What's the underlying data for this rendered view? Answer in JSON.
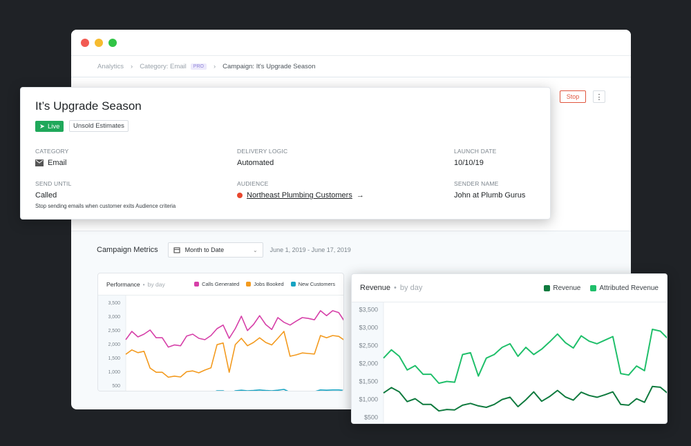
{
  "breadcrumb": {
    "items": [
      "Analytics",
      "Category: Email",
      "Campaign: It's Upgrade Season"
    ],
    "badge": "PRO"
  },
  "header": {
    "stop_label": "Stop",
    "more_icon": "kebab-icon"
  },
  "campaign": {
    "title": "It’s Upgrade Season",
    "status": "Live",
    "tag": "Unsold Estimates",
    "category_label": "CATEGORY",
    "category": "Email",
    "delivery_label": "DELIVERY LOGIC",
    "delivery": "Automated",
    "launch_label": "LAUNCH DATE",
    "launch": "10/10/19",
    "send_until_label": "SEND UNTIL",
    "send_until": "Called",
    "send_until_note": "Stop sending emails when customer exits Audience criteria",
    "audience_label": "AUDIENCE",
    "audience": "Northeast Plumbing Customers",
    "sender_label": "SENDER NAME",
    "sender": "John at Plumb Gurus"
  },
  "metrics": {
    "title": "Campaign Metrics",
    "range_select": "Month to Date",
    "range": "June 1, 2019 - June 17, 2019"
  },
  "colors": {
    "live": "#1fa85a",
    "stop": "#e0553d",
    "audience_dot": "#e8472e"
  },
  "chart_data": [
    {
      "type": "line",
      "title": "Performance",
      "subtitle": "by day",
      "ylim": [
        250,
        3750
      ],
      "yticks": [
        500,
        1000,
        1500,
        2000,
        2500,
        3000,
        3500
      ],
      "ytick_labels": [
        "500",
        "1,000",
        "1,500",
        "2,000",
        "2,500",
        "3,000",
        "3,500"
      ],
      "legend": "top-right",
      "grid": false,
      "series": [
        {
          "name": "Calls Generated",
          "color": "#d63fa8",
          "values": [
            2150,
            2450,
            2250,
            2350,
            2500,
            2220,
            2220,
            1880,
            1960,
            1930,
            2280,
            2350,
            2200,
            2150,
            2300,
            2550,
            2680,
            2200,
            2550,
            3000,
            2480,
            2700,
            3020,
            2700,
            2520,
            2950,
            2780,
            2680,
            2820,
            2950,
            2920,
            2870,
            3200,
            3020,
            3200,
            3130,
            2800
          ]
        },
        {
          "name": "Jobs Booked",
          "color": "#f39a1e",
          "values": [
            1620,
            1780,
            1680,
            1730,
            1120,
            970,
            970,
            790,
            830,
            800,
            990,
            1020,
            950,
            1050,
            1130,
            1970,
            2030,
            970,
            1970,
            2200,
            1930,
            2050,
            2220,
            2050,
            1960,
            2200,
            2450,
            1550,
            1600,
            1670,
            1650,
            1630,
            2300,
            2220,
            2300,
            2270,
            2120
          ]
        },
        {
          "name": "New Customers",
          "color": "#17a3c2",
          "values": [
            260,
            280,
            270,
            270,
            210,
            190,
            190,
            180,
            180,
            180,
            200,
            210,
            200,
            210,
            220,
            300,
            300,
            200,
            300,
            320,
            300,
            310,
            330,
            310,
            300,
            320,
            350,
            250,
            260,
            270,
            270,
            270,
            330,
            320,
            330,
            330,
            310
          ]
        }
      ]
    },
    {
      "type": "line",
      "title": "Revenue",
      "subtitle": "by day",
      "ylim": [
        300,
        3700
      ],
      "yticks": [
        500,
        1000,
        1500,
        2000,
        2500,
        3000,
        3500
      ],
      "ytick_labels": [
        "$500",
        "$1,000",
        "$1,500",
        "$2,000",
        "$2,500",
        "$3,000",
        "$3,500"
      ],
      "legend": "top-right",
      "grid": false,
      "series": [
        {
          "name": "Revenue",
          "color": "#0f7a3e",
          "values": [
            1180,
            1330,
            1210,
            940,
            1020,
            860,
            860,
            680,
            720,
            710,
            840,
            890,
            820,
            780,
            860,
            1000,
            1060,
            800,
            990,
            1210,
            950,
            1080,
            1250,
            1070,
            980,
            1200,
            1110,
            1060,
            1130,
            1210,
            860,
            840,
            1020,
            920,
            1360,
            1340,
            1160
          ]
        },
        {
          "name": "Attributed Revenue",
          "color": "#1fbf6a",
          "values": [
            2150,
            2380,
            2200,
            1820,
            1940,
            1700,
            1700,
            1450,
            1500,
            1480,
            2250,
            2300,
            1650,
            2150,
            2250,
            2450,
            2550,
            2200,
            2450,
            2250,
            2400,
            2600,
            2820,
            2580,
            2430,
            2770,
            2620,
            2550,
            2650,
            2750,
            1720,
            1680,
            1930,
            1800,
            2950,
            2900,
            2680
          ]
        }
      ]
    }
  ]
}
